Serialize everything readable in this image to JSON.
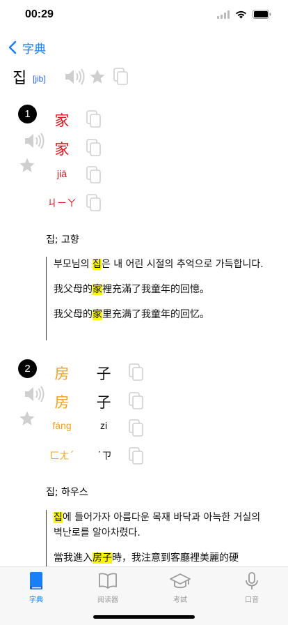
{
  "status": {
    "time": "00:29"
  },
  "nav": {
    "back_label": "字典"
  },
  "headword": {
    "word": "집",
    "pron": "[jib]"
  },
  "senses": [
    {
      "number": "1",
      "trad_chars": [
        "家"
      ],
      "simp_chars": [
        "家"
      ],
      "pinyin": [
        "jiā"
      ],
      "zhuyin": [
        "ㄐㄧㄚ"
      ],
      "gloss": "집; 고향",
      "examples": [
        {
          "before": "부모님의 ",
          "highlight": "집",
          "after": "은 내 어린 시절의 추억으로 가득합니다."
        },
        {
          "before": "我父母的",
          "highlight": "家",
          "after": "裡充滿了我童年的回憶。"
        },
        {
          "before": "我父母的",
          "highlight": "家",
          "after": "里充满了我童年的回忆。"
        }
      ]
    },
    {
      "number": "2",
      "trad_chars": [
        "房",
        "子"
      ],
      "simp_chars": [
        "房",
        "子"
      ],
      "pinyin": [
        "fáng",
        "zi"
      ],
      "zhuyin": [
        "ㄈㄤˊ",
        "˙ㄗ"
      ],
      "gloss": "집; 하우스",
      "examples": [
        {
          "before": "",
          "highlight": "집",
          "after": "에 들어가자 아름다운 목재 바닥과 아늑한 거실의 벽난로를 알아차렸다."
        },
        {
          "before": "當我進入",
          "highlight": "房子",
          "after": "時，我注意到客廳裡美麗的硬"
        }
      ]
    }
  ],
  "tabs": [
    {
      "label": "字典",
      "icon": "book-icon",
      "active": true
    },
    {
      "label": "阅读器",
      "icon": "open-book-icon",
      "active": false
    },
    {
      "label": "考試",
      "icon": "graduation-cap-icon",
      "active": false
    },
    {
      "label": "口音",
      "icon": "microphone-icon",
      "active": false
    }
  ],
  "colors": {
    "accent": "#1a7ef5",
    "trad": "#e0121b",
    "tone2": "#f5a01a",
    "highlight": "#fbf600"
  }
}
